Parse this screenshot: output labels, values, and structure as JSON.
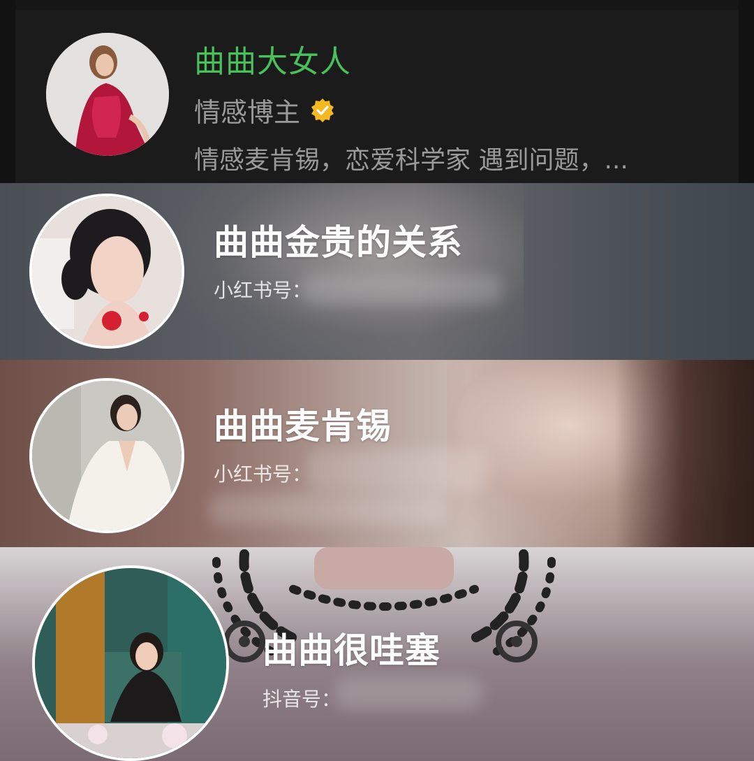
{
  "wechat_card": {
    "name": "曲曲大女人",
    "role": "情感博主",
    "description": "情感麦肯锡，恋爱科学家 遇到问题，...",
    "verified_icon": "verified-badge-icon",
    "colors": {
      "name": "#49c15b",
      "text": "#9a9a9a",
      "badge": "#f5b820"
    }
  },
  "xhs_card_1": {
    "title": "曲曲金贵的关系",
    "id_label": "小红书号："
  },
  "xhs_card_2": {
    "title": "曲曲麦肯锡",
    "id_label": "小红书号："
  },
  "douyin_card": {
    "title": "曲曲很哇塞",
    "id_label": "抖音号："
  }
}
